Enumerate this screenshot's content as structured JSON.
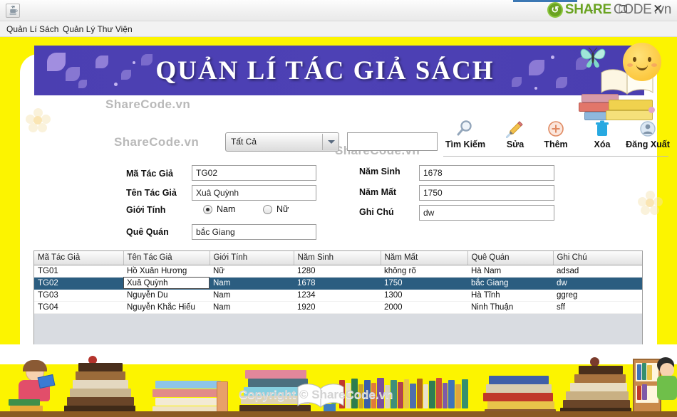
{
  "window": {
    "app_icon": "java-coffee-icon",
    "minimize_label": "–",
    "maximize_label": "❐",
    "close_label": "✕"
  },
  "brand": {
    "mark": "share-icon",
    "share": "SHARE",
    "code": "CODE",
    "vn": ".vn"
  },
  "menubar": {
    "items": [
      {
        "label": "Quản Lí Sách"
      },
      {
        "label": "Quản Lý Thư Viện"
      }
    ]
  },
  "banner": {
    "title": "QUẢN LÍ TÁC GIẢ SÁCH"
  },
  "search": {
    "filter_value": "Tất Cả",
    "filter_options": [
      "Tất Cả"
    ],
    "keyword_value": "",
    "keyword_placeholder": ""
  },
  "toolbar": {
    "buttons": [
      {
        "label": "Tìm Kiếm",
        "icon": "magnifier-icon"
      },
      {
        "label": "Sửa",
        "icon": "pencil-icon"
      },
      {
        "label": "Thêm",
        "icon": "plus-circle-icon"
      },
      {
        "label": "Xóa",
        "icon": "trash-icon"
      },
      {
        "label": "Đăng Xuất",
        "icon": "user-avatar-icon"
      }
    ]
  },
  "form": {
    "ma_tac_gia_label": "Mã Tác Giả",
    "ma_tac_gia_value": "TG02",
    "ten_tac_gia_label": "Tên Tác Giả",
    "ten_tac_gia_value": "Xuâ Quỳnh",
    "gioi_tinh_label": "Giới Tính",
    "gioi_tinh_nam": "Nam",
    "gioi_tinh_nu": "Nữ",
    "gioi_tinh_selected": "Nam",
    "que_quan_label": "Quê Quán",
    "que_quan_value": "bắc Giang",
    "nam_sinh_label": "Năm Sinh",
    "nam_sinh_value": "1678",
    "nam_mat_label": "Năm Mất",
    "nam_mat_value": "1750",
    "ghi_chu_label": "Ghi Chú",
    "ghi_chu_value": "dw"
  },
  "table": {
    "columns": [
      "Mã Tác Giả",
      "Tên Tác Giả",
      "Giới Tính",
      "Năm Sinh",
      "Năm Mất",
      "Quê Quán",
      "Ghi Chú"
    ],
    "rows": [
      {
        "ma": "TG01",
        "ten": "Hồ Xuân Hương",
        "gioi_tinh": "Nữ",
        "nam_sinh": "1280",
        "nam_mat": "không rõ",
        "que_quan": "Hà Nam",
        "ghi_chu": "adsad",
        "selected": false,
        "editing_cell": null
      },
      {
        "ma": "TG02",
        "ten": "Xuâ Quỳnh",
        "gioi_tinh": "Nam",
        "nam_sinh": "1678",
        "nam_mat": "1750",
        "que_quan": "bắc Giang",
        "ghi_chu": "dw",
        "selected": true,
        "editing_cell": "ten"
      },
      {
        "ma": "TG03",
        "ten": "Nguyễn Du",
        "gioi_tinh": "Nam",
        "nam_sinh": "1234",
        "nam_mat": "1300",
        "que_quan": "Hà Tĩnh",
        "ghi_chu": "ggreg",
        "selected": false,
        "editing_cell": null
      },
      {
        "ma": "TG04",
        "ten": "Nguyễn Khắc Hiếu",
        "gioi_tinh": "Nam",
        "nam_sinh": "1920",
        "nam_mat": "2000",
        "que_quan": "Ninh Thuận",
        "ghi_chu": "sff",
        "selected": false,
        "editing_cell": null
      }
    ]
  },
  "watermarks": {
    "w1": "ShareCode.vn",
    "w2": "ShareCode.vn",
    "w3": "ShareCode.vn",
    "footer_copyright": "Copyright © ShareCode.vn",
    "footer_wm": "ShareCode.vn"
  },
  "colors": {
    "frame_yellow": "#fcf400",
    "banner_blue": "#4b3fb1",
    "selection_blue": "#2b5d80",
    "brand_green": "#6aa321",
    "trash_blue": "#27a9e1",
    "plus_orange": "#e8825a"
  }
}
